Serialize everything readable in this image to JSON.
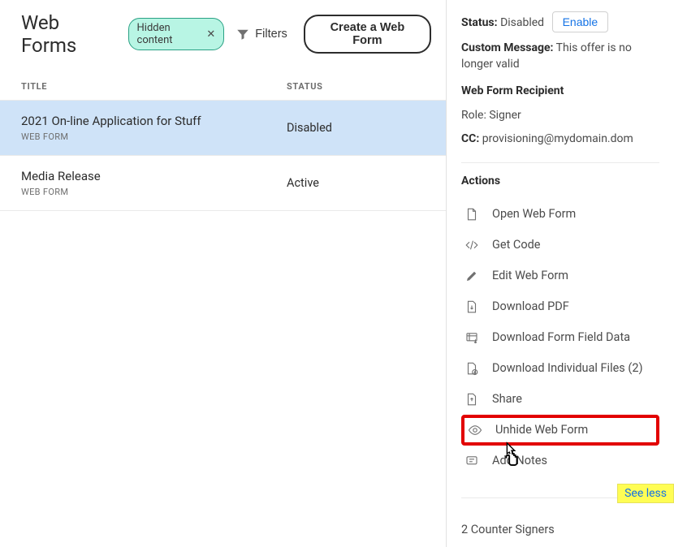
{
  "page_title": "Web Forms",
  "filter_chip": {
    "label": "Hidden content"
  },
  "filters_button": "Filters",
  "create_button": "Create a Web Form",
  "columns": {
    "title": "TITLE",
    "status": "STATUS"
  },
  "rows": [
    {
      "title": "2021 On-line Application for Stuff",
      "subtype": "WEB FORM",
      "status": "Disabled",
      "selected": true
    },
    {
      "title": "Media Release",
      "subtype": "WEB FORM",
      "status": "Active",
      "selected": false
    }
  ],
  "details": {
    "status_label": "Status:",
    "status_value": "Disabled",
    "enable_button": "Enable",
    "custom_message_label": "Custom Message:",
    "custom_message_value": "This offer is no longer valid",
    "recipient_heading": "Web Form Recipient",
    "role_label": "Role:",
    "role_value": "Signer",
    "cc_label": "CC:",
    "cc_value": "provisioning@mydomain.dom"
  },
  "actions_title": "Actions",
  "actions": [
    {
      "label": "Open Web Form"
    },
    {
      "label": "Get Code"
    },
    {
      "label": "Edit Web Form"
    },
    {
      "label": "Download PDF"
    },
    {
      "label": "Download Form Field Data"
    },
    {
      "label": "Download Individual Files (2)"
    },
    {
      "label": "Share"
    },
    {
      "label": "Unhide Web Form"
    },
    {
      "label": "Add Notes"
    }
  ],
  "see_less": "See less",
  "signers_text": "2 Counter Signers"
}
